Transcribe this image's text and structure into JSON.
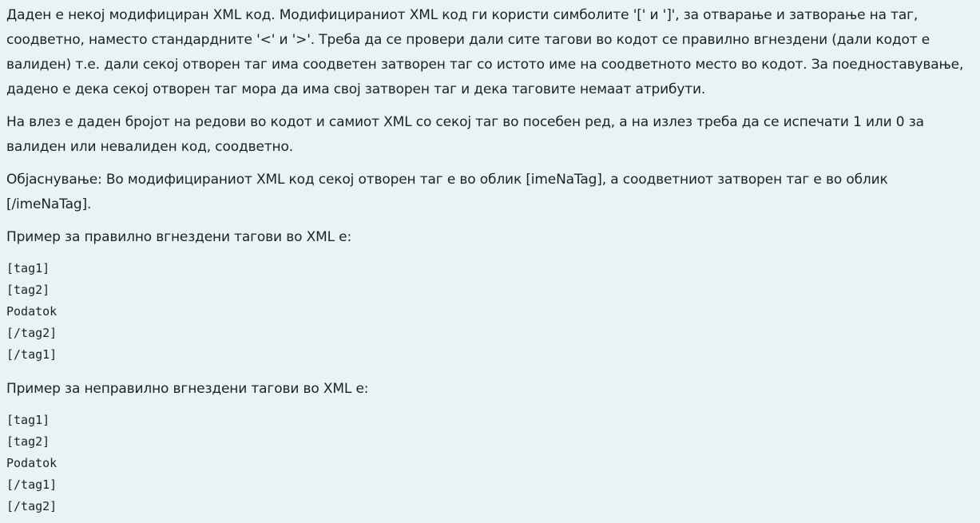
{
  "problem": {
    "paragraph1": "Даден е некој модифициран XML код. Модифицираниот XML код ги користи симболите '[' и ']', за отварање и затворање на таг, соодветно, наместо стандардните '<' и '>'. Треба да се провери дали сите тагови во кодот се правилно вгнездени (дали кодот е валиден) т.е. дали секој отворен таг има соодветен затворен таг со истото име на соодветното место во кодот. За поедноставување, дадено е дека секој отворен таг мора да има свој затворен таг и дека таговите немаат атрибути.",
    "paragraph2": "На влез е даден бројот на редови во кодот и самиот XML со секој таг во посебен ред, а на излез треба да се испечати 1 или 0 за валиден или невалиден код, соодветно.",
    "paragraph3": "Објаснување: Во модифицираниот XML код секој отворен таг е во облик [imeNaTag], а соодветниот затворен таг е во облик [/imeNaTag].",
    "valid_example": {
      "heading": "Пример за правилно вгнездени тагови во XML е:",
      "lines": [
        "[tag1]",
        "[tag2]",
        "Podatok",
        "[/tag2]",
        "[/tag1]"
      ]
    },
    "invalid_example": {
      "heading": "Пример за неправилно вгнездени тагови во XML е:",
      "lines": [
        "[tag1]",
        "[tag2]",
        "Podatok",
        "[/tag1]",
        "[/tag2]"
      ]
    }
  }
}
